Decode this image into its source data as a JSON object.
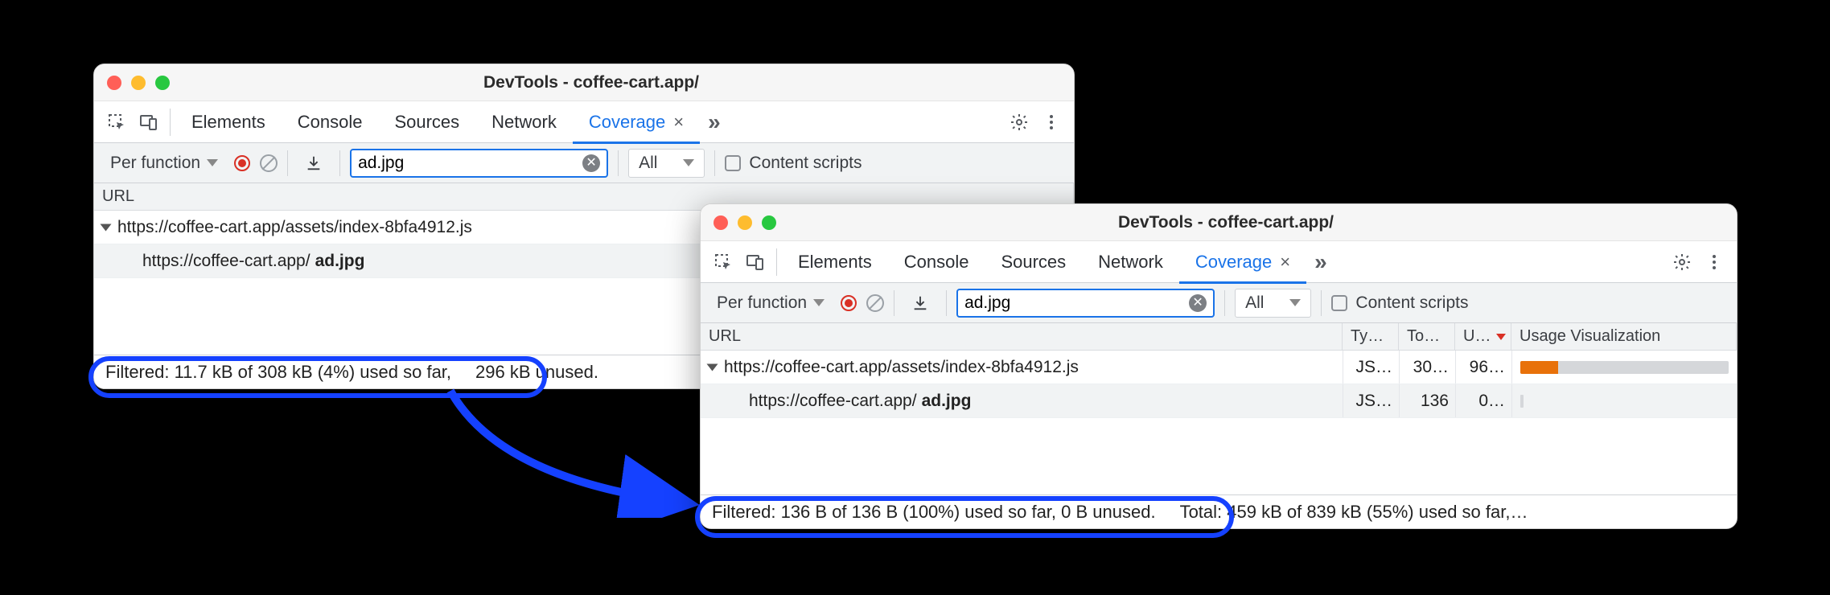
{
  "windowA": {
    "title": "DevTools - coffee-cart.app/",
    "tabs": {
      "elements": "Elements",
      "console": "Console",
      "sources": "Sources",
      "network": "Network",
      "coverage": "Coverage"
    },
    "toolbar": {
      "granularity": "Per function",
      "filter_value": "ad.jpg",
      "type_filter": "All",
      "content_scripts": "Content scripts"
    },
    "header": {
      "url": "URL"
    },
    "rows": [
      {
        "url_prefix": "https://coffee-cart.app/assets/index-8bfa4912.js",
        "bold": ""
      },
      {
        "url_prefix": "https://coffee-cart.app/",
        "bold": "ad.jpg",
        "indent": true
      }
    ],
    "status": {
      "filtered": "Filtered: 11.7 kB of 308 kB (4%) used so far,",
      "total_tail": "296 kB unused."
    }
  },
  "windowB": {
    "title": "DevTools - coffee-cart.app/",
    "tabs": {
      "elements": "Elements",
      "console": "Console",
      "sources": "Sources",
      "network": "Network",
      "coverage": "Coverage"
    },
    "toolbar": {
      "granularity": "Per function",
      "filter_value": "ad.jpg",
      "type_filter": "All",
      "content_scripts": "Content scripts"
    },
    "header": {
      "url": "URL",
      "type": "Ty…",
      "total": "To…",
      "unused": "U…",
      "vis": "Usage Visualization"
    },
    "rows": [
      {
        "url_prefix": "https://coffee-cart.app/assets/index-8bfa4912.js",
        "bold": "",
        "type": "JS…",
        "total": "30…",
        "unused": "96…",
        "used_pct": 18
      },
      {
        "url_prefix": "https://coffee-cart.app/",
        "bold": "ad.jpg",
        "indent": true,
        "type": "JS…",
        "total": "136",
        "unused": "0…",
        "used_pct": 0
      }
    ],
    "status": {
      "filtered": "Filtered: 136 B of 136 B (100%) used so far, 0 B unused.",
      "total": "Total: 459 kB of 839 kB (55%) used so far,…"
    }
  }
}
